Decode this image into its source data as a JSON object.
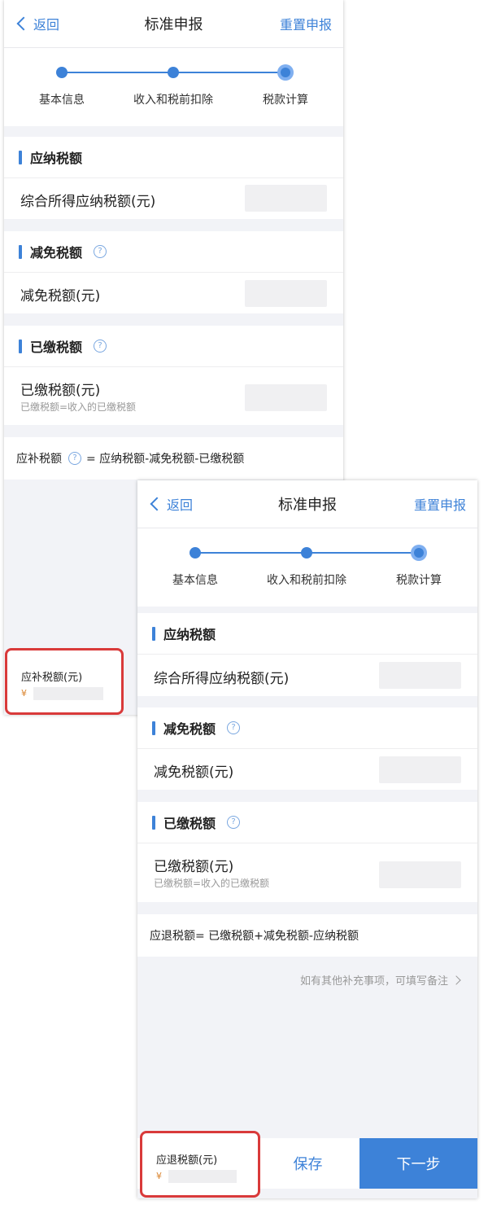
{
  "nav": {
    "back_label": "返回",
    "title": "标准申报",
    "reset_label": "重置申报"
  },
  "steps": [
    "基本信息",
    "收入和税前扣除",
    "税款计算"
  ],
  "sections": {
    "payable": {
      "title": "应纳税额",
      "row_label": "综合所得应纳税额(元)"
    },
    "reduction": {
      "title": "减免税额",
      "row_label": "减免税额(元)"
    },
    "paid": {
      "title": "已缴税额",
      "row_label": "已缴税额(元)",
      "row_hint": "已缴税额=收入的已缴税额"
    }
  },
  "screen1": {
    "formula_label": "应补税额",
    "formula_text": "= 应纳税额-减免税额-已缴税额",
    "amount_title": "应补税额(元)",
    "currency": "¥"
  },
  "screen2": {
    "formula_text": "应退税额= 已缴税额+减免税额-应纳税额",
    "remark_text": "如有其他补充事项，可填写备注",
    "amount_title": "应退税额(元)",
    "currency": "¥",
    "save_label": "保存",
    "next_label": "下一步"
  },
  "colors": {
    "accent": "#3d82d8",
    "highlight_border": "#d93a3a",
    "currency": "#d9822b"
  },
  "icons": [
    "chevron-left-icon",
    "help-circle-icon",
    "chevron-right-icon"
  ]
}
